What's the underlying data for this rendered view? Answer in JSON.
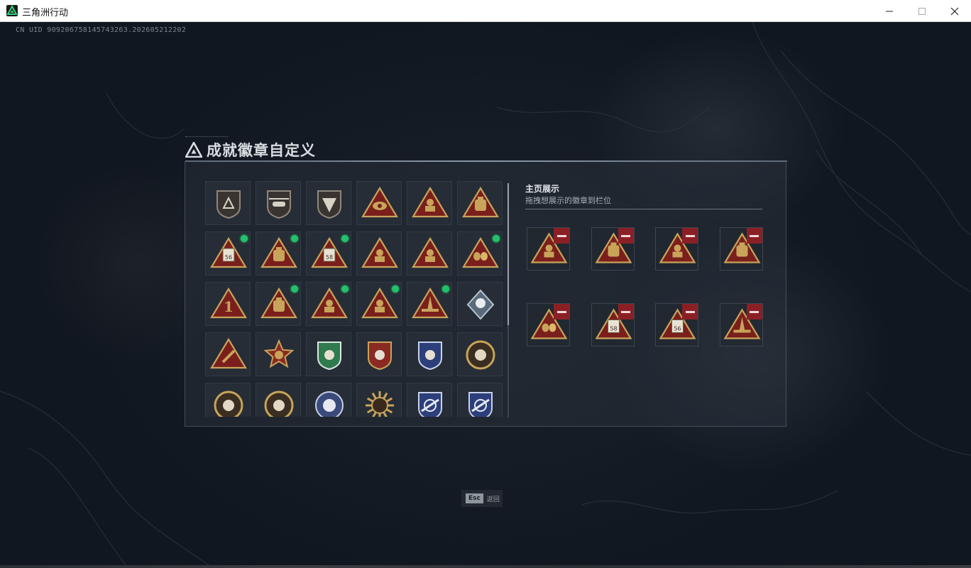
{
  "window": {
    "title": "三角洲行动",
    "minimize_label": "minimize",
    "maximize_label": "maximize",
    "close_label": "close"
  },
  "uid_text": "CN UID 9092067581457432​63.202605212202",
  "panel": {
    "title": "成就徽章自定义",
    "showcase_title": "主页展示",
    "showcase_subtitle": "拖拽想展示的徽章到栏位"
  },
  "badges": [
    {
      "icon": "shield-delta-badge",
      "new": false
    },
    {
      "icon": "helicopter-shield-badge",
      "new": false
    },
    {
      "icon": "jet-shield-badge",
      "new": false
    },
    {
      "icon": "eye-triangle-badge",
      "new": false
    },
    {
      "icon": "emblem-triangle-badge",
      "new": false
    },
    {
      "icon": "backpack-triangle-badge",
      "new": false
    },
    {
      "icon": "ammo-56-triangle-badge",
      "new": true
    },
    {
      "icon": "backpack-gold-triangle-badge",
      "new": true
    },
    {
      "icon": "ammo-58-triangle-badge",
      "new": true
    },
    {
      "icon": "table-triangle-badge",
      "new": false
    },
    {
      "icon": "hand-triangle-badge",
      "new": false
    },
    {
      "icon": "eggs-triangle-badge",
      "new": true
    },
    {
      "icon": "number-one-triangle-badge",
      "new": false
    },
    {
      "icon": "backpack-large-triangle-badge",
      "new": true
    },
    {
      "icon": "soldier-triangle-badge",
      "new": true
    },
    {
      "icon": "medic-triangle-badge",
      "new": true
    },
    {
      "icon": "rocket-triangle-badge",
      "new": true
    },
    {
      "icon": "diamond-rose-badge",
      "new": false
    },
    {
      "icon": "wrench-triangle-badge",
      "new": false
    },
    {
      "icon": "star-medal-badge",
      "new": false
    },
    {
      "icon": "green-shield-badge",
      "new": false
    },
    {
      "icon": "red-crest-badge",
      "new": false
    },
    {
      "icon": "blue-wolf-shield-badge",
      "new": false
    },
    {
      "icon": "round-helmet-badge",
      "new": false
    },
    {
      "icon": "round-skull-badge",
      "new": false
    },
    {
      "icon": "round-eagle-badge",
      "new": false
    },
    {
      "icon": "round-rose-badge",
      "new": false
    },
    {
      "icon": "sunburst-badge",
      "new": false
    },
    {
      "icon": "crosshair-shield-badge",
      "new": false
    },
    {
      "icon": "crosshair-shield-2-badge",
      "new": false
    }
  ],
  "showcase_slots": [
    {
      "icon": "soldier-triangle-badge"
    },
    {
      "icon": "backpack-large-triangle-badge"
    },
    {
      "icon": "medic-triangle-badge"
    },
    {
      "icon": "backpack-gold-triangle-badge"
    },
    {
      "icon": "eggs-triangle-badge"
    },
    {
      "icon": "ammo-58-triangle-badge"
    },
    {
      "icon": "ammo-56-triangle-badge"
    },
    {
      "icon": "rocket-triangle-badge"
    }
  ],
  "esc": {
    "key": "Esc",
    "label": "返回"
  },
  "colors": {
    "new_indicator": "#22c26a",
    "remove_button": "#8a2026",
    "badge_gold": "#c8a45a",
    "badge_red": "#7a1f1c"
  }
}
